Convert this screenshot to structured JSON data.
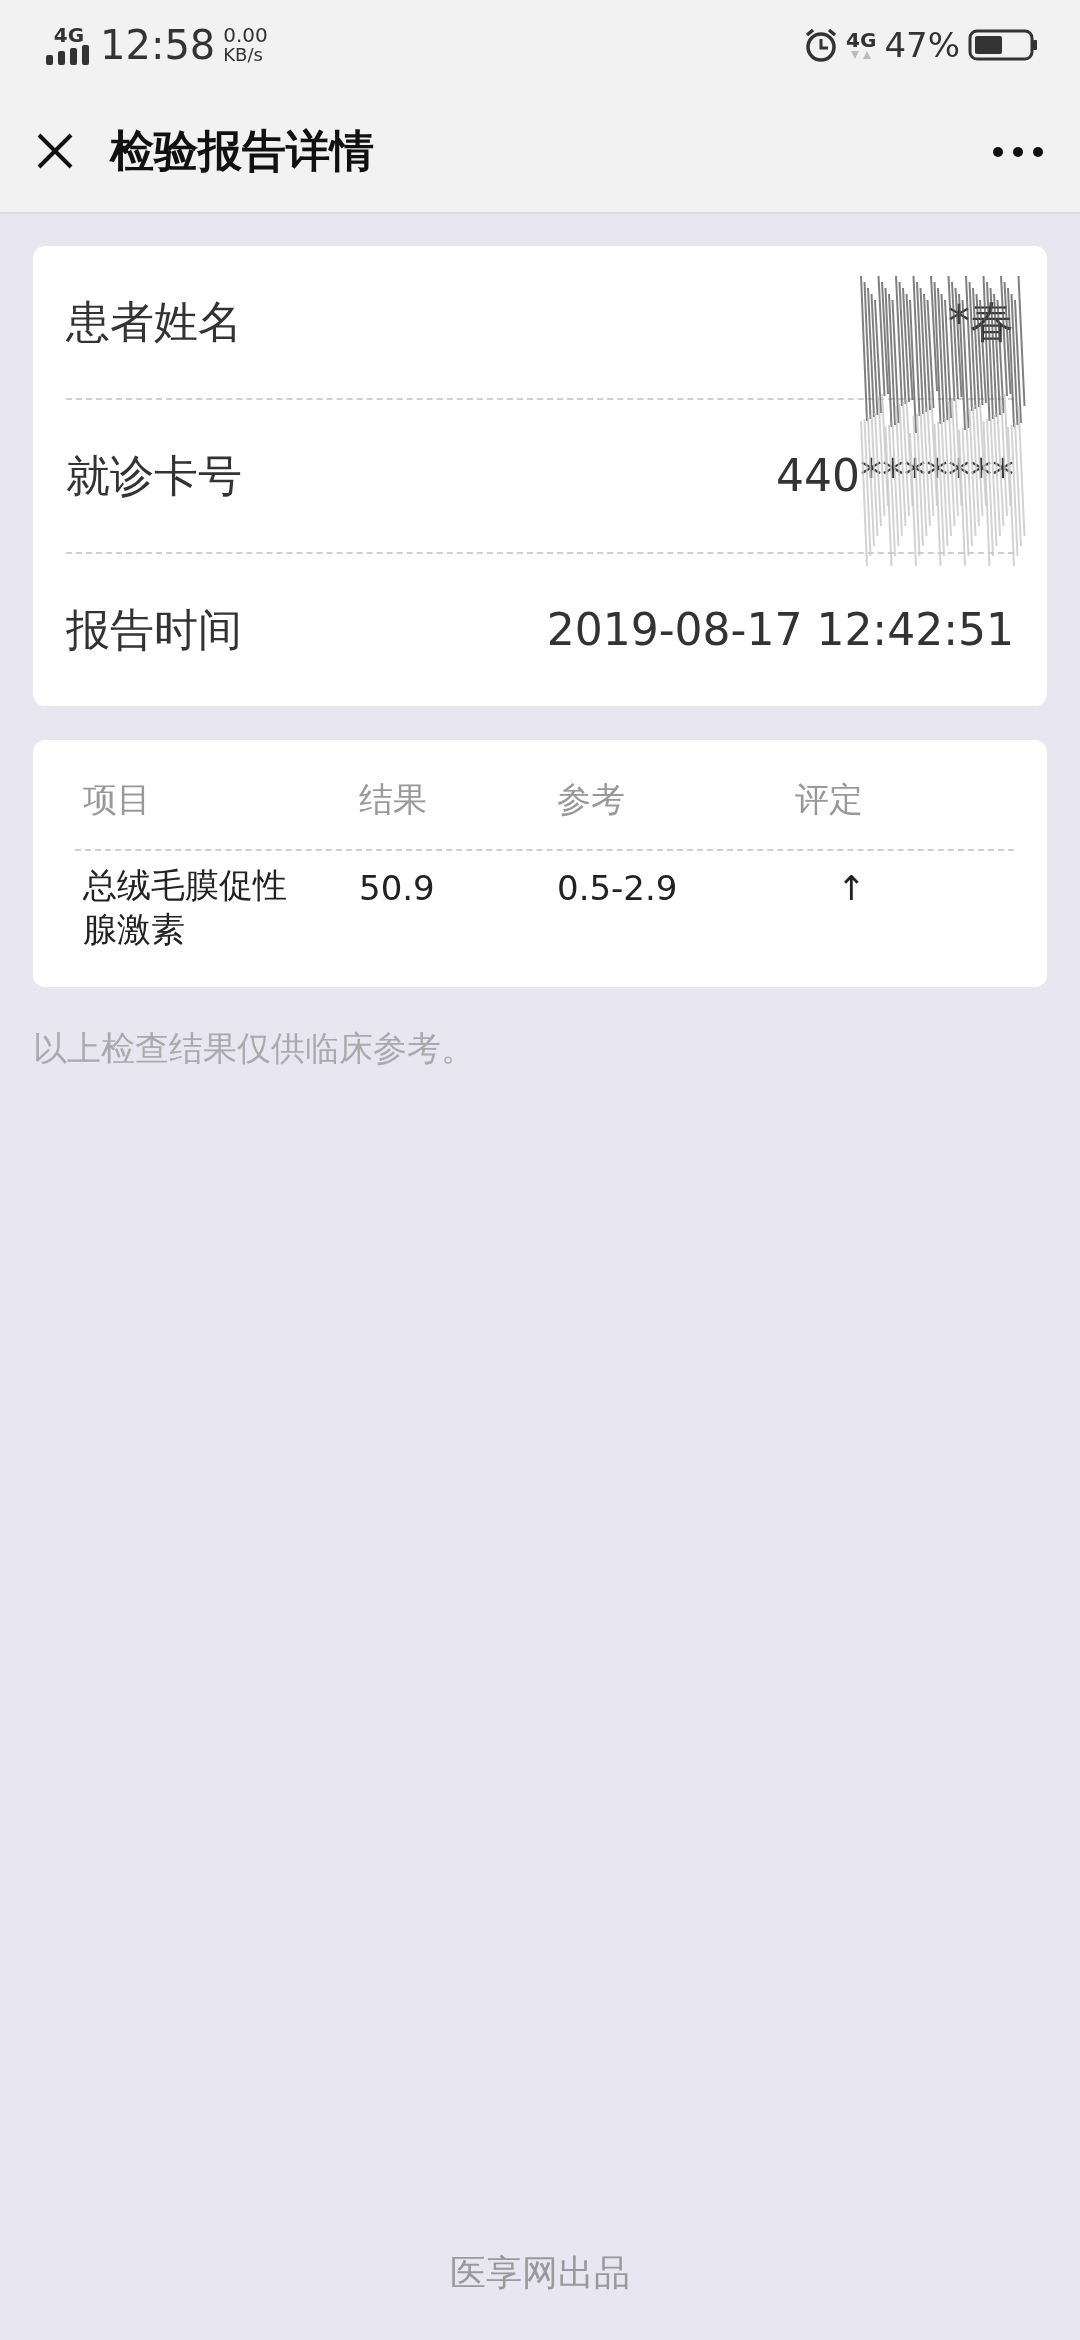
{
  "status_bar": {
    "network_left": "4G",
    "time": "12:58",
    "speed_value": "0.00",
    "speed_unit": "KB/s",
    "network_right": "4G",
    "battery": "47%"
  },
  "header": {
    "title": "检验报告详情"
  },
  "patient_info": [
    {
      "label": "患者姓名",
      "value": "*春"
    },
    {
      "label": "就诊卡号",
      "value": "440*******"
    },
    {
      "label": "报告时间",
      "value": "2019-08-17 12:42:51"
    }
  ],
  "results_table": {
    "columns": [
      "项目",
      "结果",
      "参考",
      "评定"
    ],
    "rows": [
      {
        "item": "总绒毛膜促性腺激素",
        "result": "50.9",
        "reference": "0.5-2.9",
        "flag": "↑"
      }
    ]
  },
  "note": "以上检查结果仅供临床参考。",
  "footer": "医享网出品"
}
